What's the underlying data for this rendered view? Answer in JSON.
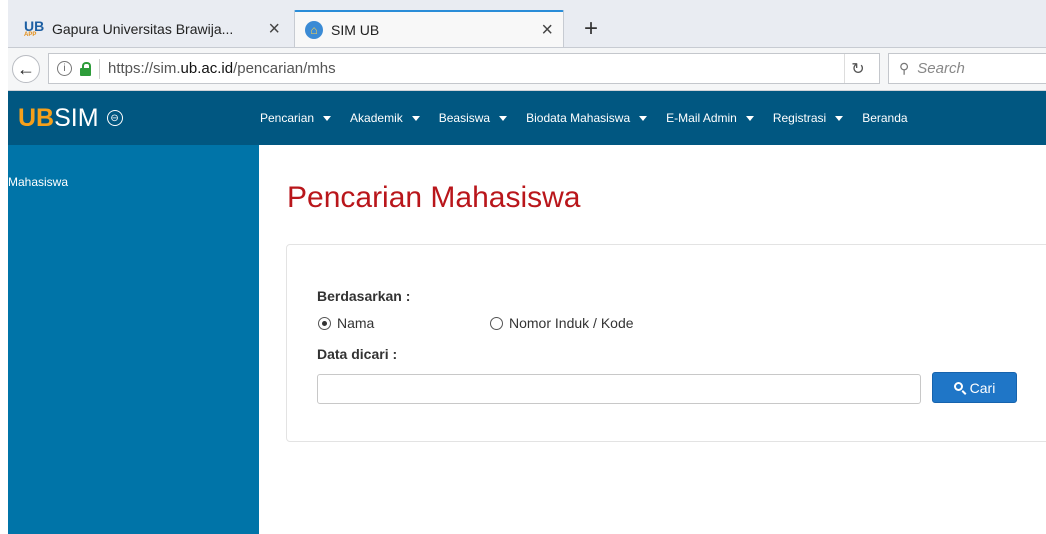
{
  "browser": {
    "tabs": [
      {
        "title": "Gapura Universitas Brawija...",
        "favicon": "UB",
        "favicon_sub": "APP",
        "close": "×",
        "active": false
      },
      {
        "title": "SIM UB",
        "favicon": "home-icon",
        "close": "×",
        "active": true
      }
    ],
    "new_tab": "+",
    "url_prefix": "https://sim.",
    "url_host": "ub.ac.id",
    "url_path": "/pencarian/mhs",
    "search_placeholder": "Search",
    "reload": "↻",
    "back": "←"
  },
  "header": {
    "brand_ub": "UB",
    "brand_sim": "SIM",
    "toggle_icon": "⊖",
    "menu": [
      "Pencarian",
      "Akademik",
      "Beasiswa",
      "Biodata Mahasiswa",
      "E-Mail Admin",
      "Registrasi",
      "Beranda"
    ],
    "accent_color": "#f6a01a",
    "header_color": "#015781"
  },
  "sidebar": {
    "items": [
      "Mahasiswa"
    ],
    "color": "#0074a8"
  },
  "main": {
    "title": "Pencarian Mahasiswa",
    "title_color": "#b9161b",
    "berdasarkan_label": "Berdasarkan :",
    "options": [
      {
        "label": "Nama",
        "selected": true
      },
      {
        "label": "Nomor Induk / Kode",
        "selected": false
      }
    ],
    "data_label": "Data dicari :",
    "search_value": "",
    "search_button": "Cari"
  }
}
